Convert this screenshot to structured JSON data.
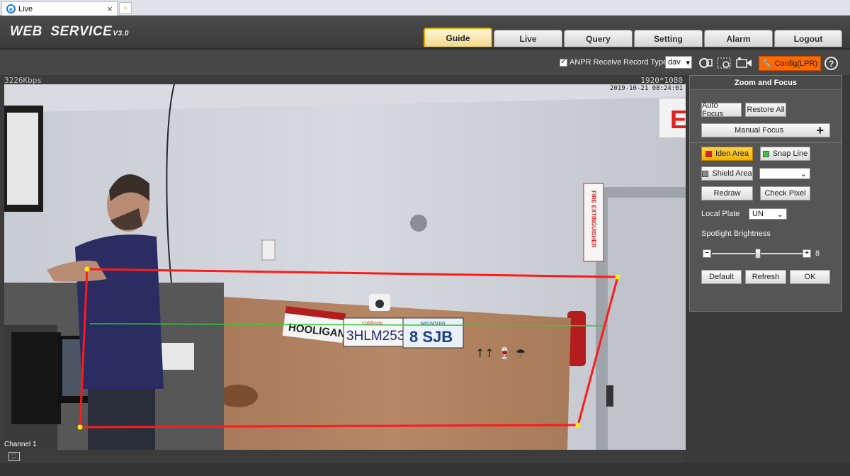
{
  "browser": {
    "tab_title": "Live",
    "close_glyph": "×"
  },
  "header": {
    "brand": "WEB  SERVICE",
    "version": "V3.0"
  },
  "nav": [
    {
      "label": "Guide",
      "active": true
    },
    {
      "label": "Live"
    },
    {
      "label": "Query"
    },
    {
      "label": "Setting"
    },
    {
      "label": "Alarm"
    },
    {
      "label": "Logout"
    }
  ],
  "toolbar": {
    "anpr_label": "ANPR Receive",
    "anpr_checked": true,
    "record_type_label": "Record Type",
    "record_type_value": "dav",
    "config_label": "Config(LPR)",
    "help_glyph": "?"
  },
  "video": {
    "bitrate": "3226Kbps",
    "resolution": "1920*1080",
    "timestamp": "2019-10-21 08:24:01",
    "channel": "Channel 1",
    "scene_signs": {
      "exit": "EXIT",
      "fire": "FIRE EXTINGUISHER"
    },
    "plates": [
      "HOOLIGAN",
      "3HLM253",
      "8 SJB"
    ],
    "plate_headers": [
      "California",
      "MISSOURI"
    ],
    "crate_symbols": "↑↑ 🍷 ☂"
  },
  "panel": {
    "title": "Zoom and Focus",
    "auto_focus": "Auto Focus",
    "restore_all": "Restore All",
    "manual_focus": "Manual Focus",
    "manual_focus_plus": "+",
    "iden_area": "Iden Area",
    "snap_line": "Snap Line",
    "shield_area": "Shield Area",
    "shield_select_value": "",
    "redraw": "Redraw",
    "check_pixel": "Check Pixel",
    "local_plate_label": "Local Plate",
    "local_plate_value": "UN",
    "spotlight_label": "Spotlight Brightness",
    "spotlight_value": "8",
    "spotlight_min": 0,
    "spotlight_max": 16,
    "minus_glyph": "−",
    "plus_glyph": "+",
    "default_btn": "Default",
    "refresh_btn": "Refresh",
    "ok_btn": "OK"
  },
  "colors": {
    "iden_area": "#e02020",
    "snap_line": "#3cc43c",
    "shield_area": "#888888",
    "config_accent": "#ff6a00",
    "active_tab_border": "#e8a800"
  }
}
